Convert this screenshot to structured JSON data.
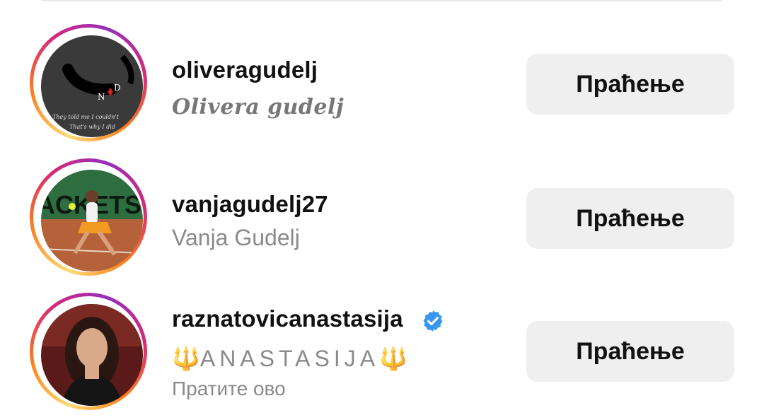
{
  "suggestions": [
    {
      "username": "oliveragudelj",
      "full_name": "Olivera gudelj",
      "avatar_text": [
        "N",
        "D",
        "They told me I couldn't",
        "That's why I did"
      ],
      "follow_label": "Праћење",
      "verified": false
    },
    {
      "username": "vanjagudelj27",
      "full_name": "Vanja Gudelj",
      "avatar_text": [
        "ACKETS"
      ],
      "follow_label": "Праћење",
      "verified": false
    },
    {
      "username": "raznatovicanastasija",
      "full_name_prefix": "🔱",
      "full_name_core": "ANASTASIJA",
      "full_name_suffix": "🔱",
      "subtitle": "Пратите ово",
      "follow_label": "Праћење",
      "verified": true
    }
  ],
  "colors": {
    "button_bg": "#efefef",
    "verified_blue": "#3897f0",
    "story_ring": [
      "#feda75",
      "#fa7e1e",
      "#d62976",
      "#962fbf"
    ]
  }
}
